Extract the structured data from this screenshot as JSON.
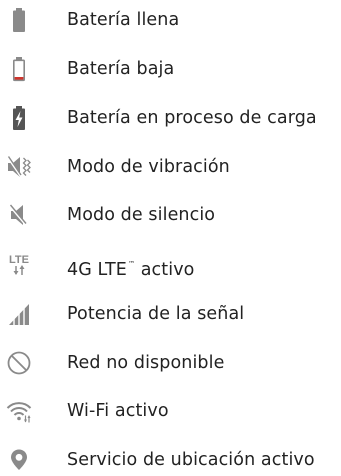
{
  "items": [
    {
      "icon": "battery-full-icon",
      "label": "Batería llena"
    },
    {
      "icon": "battery-low-icon",
      "label": "Batería baja"
    },
    {
      "icon": "battery-charging-icon",
      "label": "Batería en proceso de carga"
    },
    {
      "icon": "vibrate-mode-icon",
      "label": "Modo de vibración"
    },
    {
      "icon": "silent-mode-icon",
      "label": "Modo de silencio"
    },
    {
      "icon": "lte-icon",
      "label": "4G LTE",
      "label_suffix": "™",
      "label_after": " activo",
      "icon_text": "LTE"
    },
    {
      "icon": "signal-strength-icon",
      "label": "Potencia de la señal"
    },
    {
      "icon": "network-unavailable-icon",
      "label": "Red no disponible"
    },
    {
      "icon": "wifi-active-icon",
      "label": "Wi-Fi activo"
    },
    {
      "icon": "location-icon",
      "label": "Servicio de ubicación activo"
    }
  ],
  "colors": {
    "icon_gray": "#8a8a8a",
    "battery_low_red": "#d0342c",
    "text": "#222222"
  }
}
